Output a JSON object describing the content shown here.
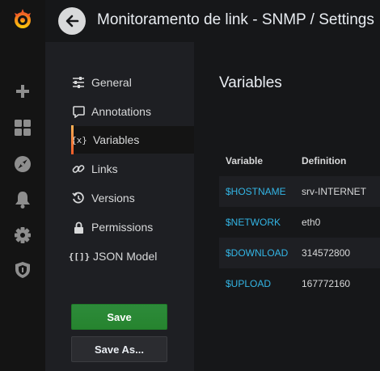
{
  "header": {
    "title": "Monitoramento de link - SNMP / Settings"
  },
  "sidemenu": {
    "items": [
      "grafana-logo-icon",
      "plus-icon",
      "dashboards-icon",
      "explore-icon",
      "alerting-icon",
      "configuration-icon",
      "shield-icon"
    ]
  },
  "settings_nav": {
    "items": [
      {
        "label": "General",
        "icon": "sliders-icon"
      },
      {
        "label": "Annotations",
        "icon": "comment-icon"
      },
      {
        "label": "Variables",
        "icon": "variable-icon",
        "active": true
      },
      {
        "label": "Links",
        "icon": "link-icon"
      },
      {
        "label": "Versions",
        "icon": "history-icon"
      },
      {
        "label": "Permissions",
        "icon": "lock-icon"
      },
      {
        "label": "JSON Model",
        "icon": "code-icon"
      }
    ],
    "save_label": "Save",
    "save_as_label": "Save As..."
  },
  "main": {
    "section_title": "Variables",
    "table": {
      "headers": [
        "Variable",
        "Definition"
      ],
      "rows": [
        {
          "variable": "$HOSTNAME",
          "definition": "srv-INTERNET"
        },
        {
          "variable": "$NETWORK",
          "definition": "eth0"
        },
        {
          "variable": "$DOWNLOAD",
          "definition": "314572800"
        },
        {
          "variable": "$UPLOAD",
          "definition": "167772160"
        }
      ]
    }
  },
  "colors": {
    "accent_link": "#33b5e5",
    "save_green": "#299c46",
    "active_indicator": "#f05a28"
  }
}
